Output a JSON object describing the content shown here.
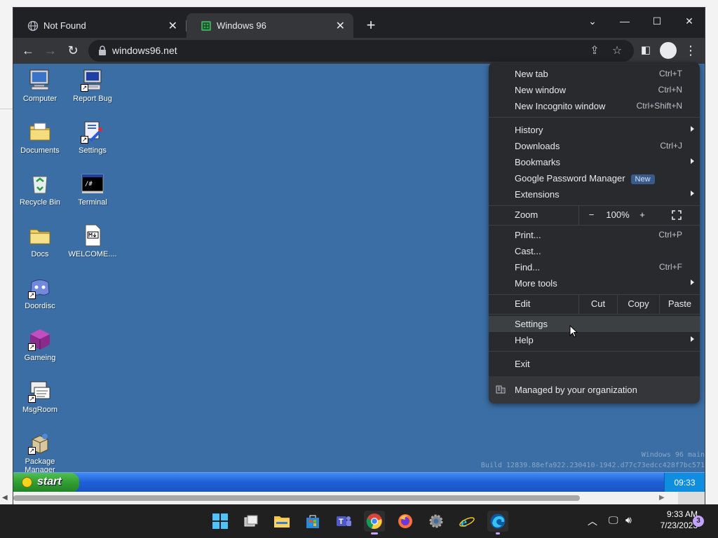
{
  "browser": {
    "tabs": [
      {
        "title": "Not Found",
        "icon": "globe-icon"
      },
      {
        "title": "Windows 96",
        "icon": "windows96-favicon",
        "active": true
      }
    ],
    "url": "windows96.net"
  },
  "desktop": {
    "icons": [
      {
        "label": "Computer",
        "icon": "computer-icon"
      },
      {
        "label": "Report Bug",
        "icon": "report-bug-icon"
      },
      {
        "label": "Documents",
        "icon": "documents-folder-icon"
      },
      {
        "label": "Settings",
        "icon": "settings-icon"
      },
      {
        "label": "Recycle Bin",
        "icon": "recycle-bin-icon"
      },
      {
        "label": "Terminal",
        "icon": "terminal-icon"
      },
      {
        "label": "Docs",
        "icon": "folder-icon"
      },
      {
        "label": "WELCOME....",
        "icon": "markdown-file-icon"
      },
      {
        "label": "Doordisc",
        "icon": "discord-icon"
      },
      {
        "label": "Gameing",
        "icon": "game-cube-icon"
      },
      {
        "label": "MsgRoom",
        "icon": "msgroom-icon"
      },
      {
        "label": "Package Manager",
        "icon": "package-manager-icon"
      }
    ],
    "build_line1": "Windows 96 main",
    "build_line2": "Build 12839.88efa922.230410-1942.d77c73edcc428f7bc571",
    "start_label": "start",
    "clock": "09:33"
  },
  "menu": {
    "new_tab": {
      "label": "New tab",
      "shortcut": "Ctrl+T"
    },
    "new_window": {
      "label": "New window",
      "shortcut": "Ctrl+N"
    },
    "incognito": {
      "label": "New Incognito window",
      "shortcut": "Ctrl+Shift+N"
    },
    "history": {
      "label": "History"
    },
    "downloads": {
      "label": "Downloads",
      "shortcut": "Ctrl+J"
    },
    "bookmarks": {
      "label": "Bookmarks"
    },
    "password_manager": {
      "label": "Google Password Manager",
      "badge": "New"
    },
    "extensions": {
      "label": "Extensions"
    },
    "zoom": {
      "label": "Zoom",
      "minus": "−",
      "value": "100%",
      "plus": "+"
    },
    "print": {
      "label": "Print...",
      "shortcut": "Ctrl+P"
    },
    "cast": {
      "label": "Cast..."
    },
    "find": {
      "label": "Find...",
      "shortcut": "Ctrl+F"
    },
    "more_tools": {
      "label": "More tools"
    },
    "edit": {
      "label": "Edit",
      "cut": "Cut",
      "copy": "Copy",
      "paste": "Paste"
    },
    "settings": {
      "label": "Settings"
    },
    "help": {
      "label": "Help"
    },
    "exit": {
      "label": "Exit"
    },
    "managed": {
      "label": "Managed by your organization"
    }
  },
  "windows_taskbar": {
    "time": "9:33 AM",
    "date": "7/23/2023",
    "notification_count": "3"
  }
}
